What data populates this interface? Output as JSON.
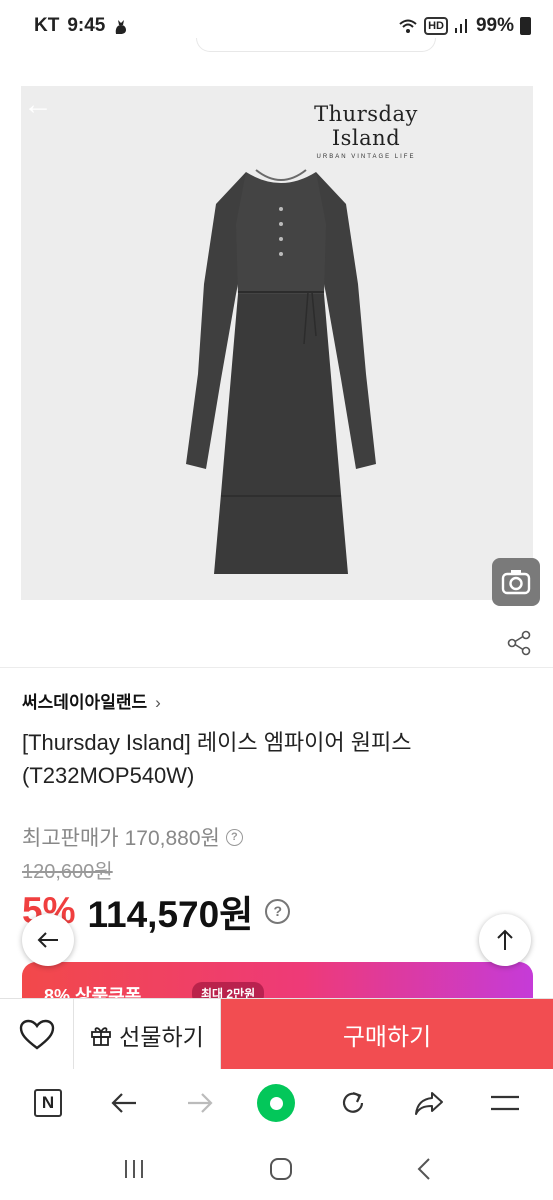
{
  "status_bar": {
    "carrier": "KT",
    "time": "9:45",
    "battery": "99%",
    "hd": "HD"
  },
  "product_image": {
    "brand_logo_name": "Thursday Island",
    "brand_logo_tagline": "URBAN VINTAGE LIFE",
    "dress_color": "#3a3a3a"
  },
  "product": {
    "brand": "써스데이아일랜드",
    "title": "[Thursday Island] 레이스 엠파이어 원피스(T232MOP540W)",
    "max_price_label": "최고판매가",
    "max_price": "170,880원",
    "original_price": "120,600원",
    "discount_rate": "5%",
    "sale_price": "114,570원"
  },
  "coupon": {
    "text": "8% 상품쿠폰",
    "badge": "최대 2만원"
  },
  "action_bar": {
    "gift_label": "선물하기",
    "buy_label": "구매하기"
  },
  "colors": {
    "accent_red": "#f24d51",
    "discount_red": "#f03f3f",
    "naver_green": "#03c75a"
  },
  "icons": {
    "status_bar": [
      "cat-icon",
      "wifi-icon",
      "hd-icon",
      "signal-icon",
      "battery-icon"
    ],
    "image": [
      "back-arrow-icon",
      "lens-search-icon",
      "share-icon"
    ],
    "float": [
      "arrow-left-icon",
      "arrow-up-icon"
    ],
    "toolbar": [
      "naver-home-icon",
      "back-icon",
      "forward-icon",
      "green-dot-icon",
      "refresh-icon",
      "share-arrow-icon",
      "menu-icon"
    ],
    "system_nav": [
      "recent-apps-icon",
      "home-icon",
      "system-back-icon"
    ]
  }
}
